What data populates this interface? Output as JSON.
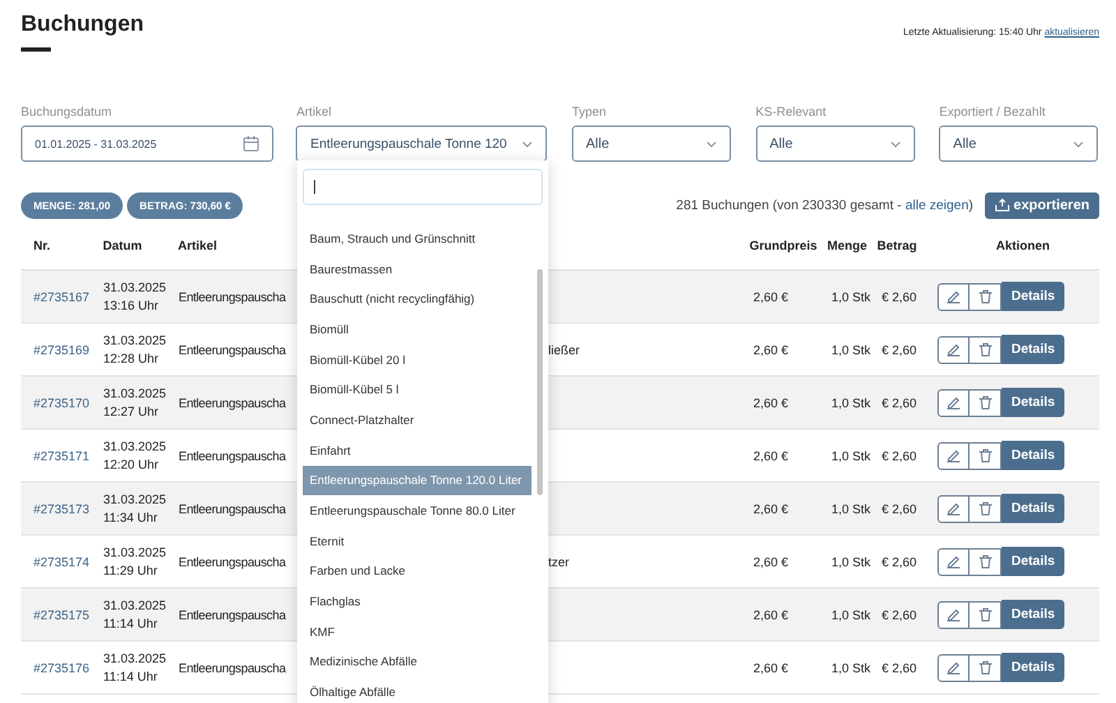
{
  "title": "Buchungen",
  "last_update": {
    "label": "Letzte Aktualisierung: 15:40 Uhr",
    "link": "aktualisieren"
  },
  "filters": [
    {
      "kind": "date",
      "label": "Buchungsdatum",
      "value": "01.01.2025 - 31.03.2025"
    },
    {
      "kind": "select",
      "label": "Artikel",
      "value": "Entleerungspauschale Tonne 120"
    },
    {
      "kind": "select",
      "label": "Typen",
      "value": "Alle"
    },
    {
      "kind": "select",
      "label": "KS-Relevant",
      "value": "Alle"
    },
    {
      "kind": "select",
      "label": "Exportiert / Bezahlt",
      "value": "Alle"
    }
  ],
  "chips": [
    "MENGE: 281,00",
    "BETRAG: 730,60 €"
  ],
  "summary": {
    "text": "281 Buchungen (von 230330 gesamt - ",
    "link": "alle zeigen",
    "close": ")"
  },
  "export_button": "exportieren",
  "table": {
    "columns": [
      "Nr.",
      "Datum",
      "Artikel",
      "Grundpreis",
      "Menge",
      "Betrag",
      "Aktionen"
    ],
    "rows": [
      {
        "nr": "#2735167",
        "date": "31.03.2025",
        "time": "13:16 Uhr",
        "article": "Entleerungspauscha",
        "price": "2,60 €",
        "qty": "1,0 Stk",
        "amount": "€ 2,60",
        "action": "Details"
      },
      {
        "nr": "#2735169",
        "date": "31.03.2025",
        "time": "12:28 Uhr",
        "article": "Entleerungspauscha",
        "article_tail": "ließer",
        "price": "2,60 €",
        "qty": "1,0 Stk",
        "amount": "€ 2,60",
        "action": "Details"
      },
      {
        "nr": "#2735170",
        "date": "31.03.2025",
        "time": "12:27 Uhr",
        "article": "Entleerungspauscha",
        "price": "2,60 €",
        "qty": "1,0 Stk",
        "amount": "€ 2,60",
        "action": "Details"
      },
      {
        "nr": "#2735171",
        "date": "31.03.2025",
        "time": "12:20 Uhr",
        "article": "Entleerungspauscha",
        "price": "2,60 €",
        "qty": "1,0 Stk",
        "amount": "€ 2,60",
        "action": "Details"
      },
      {
        "nr": "#2735173",
        "date": "31.03.2025",
        "time": "11:34 Uhr",
        "article": "Entleerungspauscha",
        "price": "2,60 €",
        "qty": "1,0 Stk",
        "amount": "€ 2,60",
        "action": "Details"
      },
      {
        "nr": "#2735174",
        "date": "31.03.2025",
        "time": "11:29 Uhr",
        "article": "Entleerungspauscha",
        "article_tail": "tzer",
        "price": "2,60 €",
        "qty": "1,0 Stk",
        "amount": "€ 2,60",
        "action": "Details"
      },
      {
        "nr": "#2735175",
        "date": "31.03.2025",
        "time": "11:14 Uhr",
        "article": "Entleerungspauscha",
        "price": "2,60 €",
        "qty": "1,0 Stk",
        "amount": "€ 2,60",
        "action": "Details"
      },
      {
        "nr": "#2735176",
        "date": "31.03.2025",
        "time": "11:14 Uhr",
        "article": "Entleerungspauscha",
        "price": "2,60 €",
        "qty": "1,0 Stk",
        "amount": "€ 2,60",
        "action": "Details"
      }
    ]
  },
  "dropdown": {
    "items": [
      {
        "label": "Baum, Strauch und Grünschnitt",
        "selected": false
      },
      {
        "label": "Baurestmassen",
        "selected": false
      },
      {
        "label": "Bauschutt (nicht recyclingfähig)",
        "selected": false
      },
      {
        "label": "Biomüll",
        "selected": false
      },
      {
        "label": "Biomüll-Kübel 20 l",
        "selected": false
      },
      {
        "label": "Biomüll-Kübel 5 l",
        "selected": false
      },
      {
        "label": "Connect-Platzhalter",
        "selected": false
      },
      {
        "label": "Einfahrt",
        "selected": false
      },
      {
        "label": "Entleerungspauschale Tonne 120.0 Liter",
        "selected": true
      },
      {
        "label": "Entleerungspauschale Tonne 80.0 Liter",
        "selected": false
      },
      {
        "label": "Eternit",
        "selected": false
      },
      {
        "label": "Farben und Lacke",
        "selected": false
      },
      {
        "label": "Flachglas",
        "selected": false
      },
      {
        "label": "KMF",
        "selected": false
      },
      {
        "label": "Medizinische Abfälle",
        "selected": false
      },
      {
        "label": "Ölhaltige Abfälle",
        "selected": false
      }
    ]
  }
}
